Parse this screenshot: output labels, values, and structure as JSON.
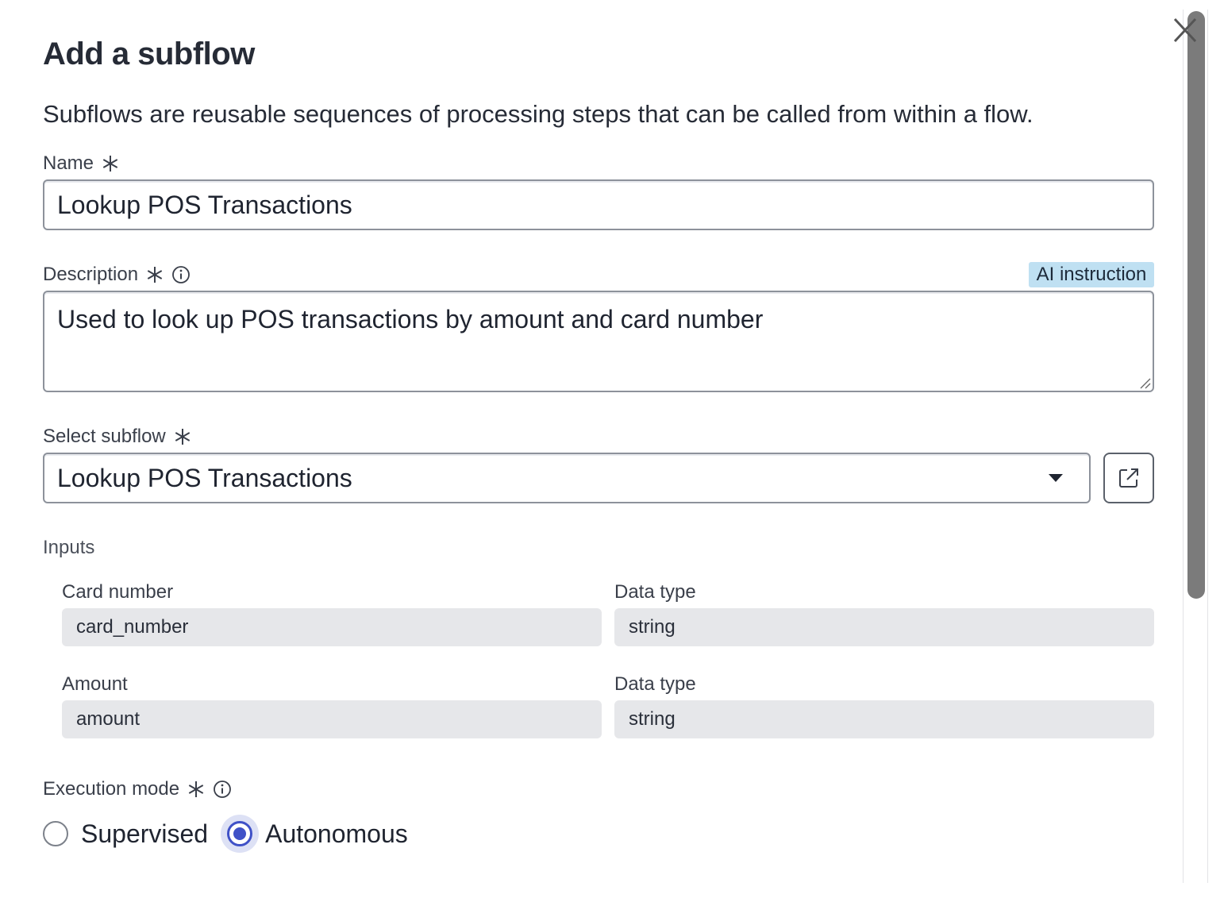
{
  "dialog": {
    "title": "Add a subflow",
    "subtitle": "Subflows are reusable sequences of processing steps that can be called from within a flow."
  },
  "name_field": {
    "label": "Name",
    "value": "Lookup POS Transactions"
  },
  "description_field": {
    "label": "Description",
    "badge": "AI instruction",
    "value": "Used to look up POS transactions by amount and card number"
  },
  "subflow_select": {
    "label": "Select subflow",
    "value": "Lookup POS Transactions"
  },
  "inputs": {
    "section_label": "Inputs",
    "rows": [
      {
        "name_label": "Card number",
        "name_value": "card_number",
        "type_label": "Data type",
        "type_value": "string"
      },
      {
        "name_label": "Amount",
        "name_value": "amount",
        "type_label": "Data type",
        "type_value": "string"
      }
    ]
  },
  "execution_mode": {
    "label": "Execution mode",
    "options": [
      {
        "label": "Supervised",
        "selected": false
      },
      {
        "label": "Autonomous",
        "selected": true
      }
    ]
  },
  "icons": {
    "close": "close-icon",
    "required": "asterisk-icon",
    "info": "info-icon",
    "dropdown": "caret-down-icon",
    "open": "external-link-icon"
  },
  "colors": {
    "accent": "#3f51c7",
    "badge_bg": "#bfe0f2",
    "readonly_bg": "#e6e7ea"
  }
}
